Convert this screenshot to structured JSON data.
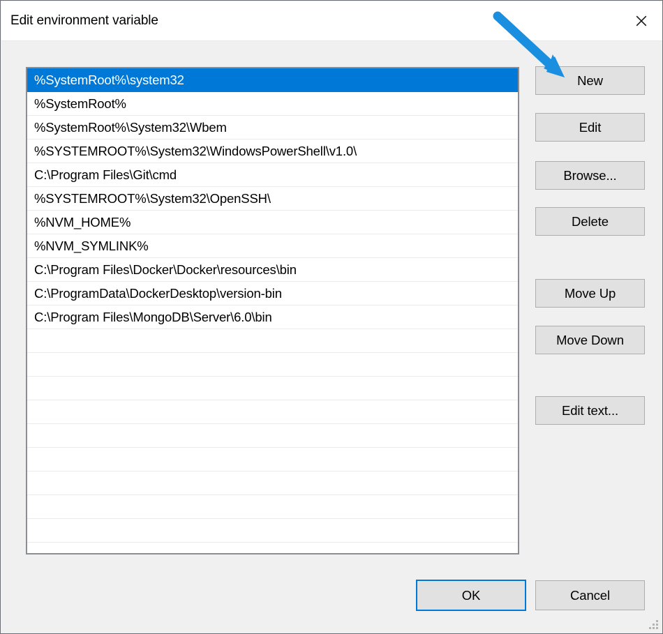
{
  "window": {
    "title": "Edit environment variable",
    "close_icon": "close-icon"
  },
  "list": {
    "selected_index": 0,
    "entries": [
      "%SystemRoot%\\system32",
      "%SystemRoot%",
      "%SystemRoot%\\System32\\Wbem",
      "%SYSTEMROOT%\\System32\\WindowsPowerShell\\v1.0\\",
      "C:\\Program Files\\Git\\cmd",
      "%SYSTEMROOT%\\System32\\OpenSSH\\",
      "%NVM_HOME%",
      "%NVM_SYMLINK%",
      "C:\\Program Files\\Docker\\Docker\\resources\\bin",
      "C:\\ProgramData\\DockerDesktop\\version-bin",
      "C:\\Program Files\\MongoDB\\Server\\6.0\\bin"
    ],
    "empty_row_count": 9
  },
  "side_buttons": {
    "new": "New",
    "edit": "Edit",
    "browse": "Browse...",
    "delete": "Delete",
    "move_up": "Move Up",
    "move_down": "Move Down",
    "edit_text": "Edit text..."
  },
  "footer": {
    "ok": "OK",
    "cancel": "Cancel",
    "resize_grip_icon": "resize-grip-icon"
  },
  "annotation": {
    "arrow_icon": "arrow-pointer-icon",
    "arrow_color": "#1a8fe0",
    "points_to": "New"
  },
  "colors": {
    "selection": "#0078d7",
    "focus_border": "#0078d7",
    "dialog_background": "#f0f0f0",
    "button_face": "#e1e1e1"
  }
}
